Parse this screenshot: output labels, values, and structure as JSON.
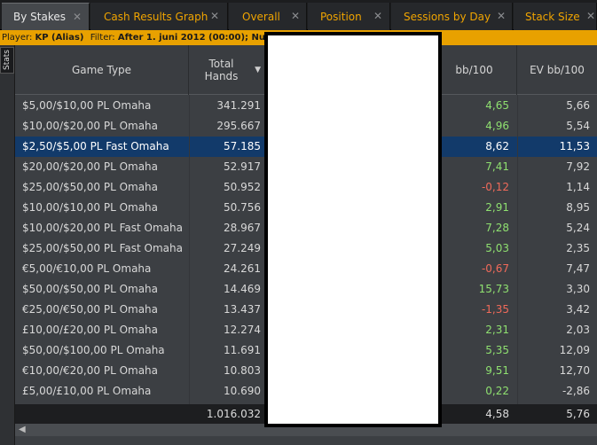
{
  "tabs": [
    {
      "label": "By Stakes",
      "active": true
    },
    {
      "label": "Cash Results Graph",
      "active": false
    },
    {
      "label": "Overall",
      "active": false
    },
    {
      "label": "Position",
      "active": false
    },
    {
      "label": "Sessions by Day",
      "active": false
    },
    {
      "label": "Stack Size",
      "active": false
    }
  ],
  "close_glyph": "✕",
  "filter": {
    "player_label": "Player:",
    "player_value": "KP (Alias)",
    "filter_label": "Filter:",
    "filter_value": "After 1. juni 2012 (00:00); Number"
  },
  "side_tab": "Stats",
  "columns": {
    "game_type": "Game Type",
    "total_hands": "Total Hands",
    "bb100": "bb/100",
    "ev_bb100": "EV bb/100"
  },
  "rows": [
    {
      "game": "$5,00/$10,00 PL Omaha",
      "hands": "341.291",
      "bb": "4,65",
      "bb_sign": "pos",
      "ev": "5,66"
    },
    {
      "game": "$10,00/$20,00 PL Omaha",
      "hands": "295.667",
      "bb": "4,96",
      "bb_sign": "pos",
      "ev": "5,54"
    },
    {
      "game": "$2,50/$5,00 PL Fast Omaha",
      "hands": "57.185",
      "bb": "8,62",
      "bb_sign": "pos",
      "ev": "11,53",
      "selected": true
    },
    {
      "game": "$20,00/$20,00 PL Omaha",
      "hands": "52.917",
      "bb": "7,41",
      "bb_sign": "pos",
      "ev": "7,92"
    },
    {
      "game": "$25,00/$50,00 PL Omaha",
      "hands": "50.952",
      "bb": "-0,12",
      "bb_sign": "neg",
      "ev": "1,14"
    },
    {
      "game": "$10,00/$10,00 PL Omaha",
      "hands": "50.756",
      "bb": "2,91",
      "bb_sign": "pos",
      "ev": "8,95"
    },
    {
      "game": "$10,00/$20,00 PL Fast Omaha",
      "hands": "28.967",
      "bb": "7,28",
      "bb_sign": "pos",
      "ev": "5,24"
    },
    {
      "game": "$25,00/$50,00 PL Fast Omaha",
      "hands": "27.249",
      "bb": "5,03",
      "bb_sign": "pos",
      "ev": "2,35"
    },
    {
      "game": "€5,00/€10,00 PL Omaha",
      "hands": "24.261",
      "bb": "-0,67",
      "bb_sign": "neg",
      "ev": "7,47"
    },
    {
      "game": "$50,00/$50,00 PL Omaha",
      "hands": "14.469",
      "bb": "15,73",
      "bb_sign": "pos",
      "ev": "3,30"
    },
    {
      "game": "€25,00/€50,00 PL Omaha",
      "hands": "13.437",
      "bb": "-1,35",
      "bb_sign": "neg",
      "ev": "3,42"
    },
    {
      "game": "£10,00/£20,00 PL Omaha",
      "hands": "12.274",
      "bb": "2,31",
      "bb_sign": "pos",
      "ev": "2,03"
    },
    {
      "game": "$50,00/$100,00 PL Omaha",
      "hands": "11.691",
      "bb": "5,35",
      "bb_sign": "pos",
      "ev": "12,09"
    },
    {
      "game": "€10,00/€20,00 PL Omaha",
      "hands": "10.803",
      "bb": "9,51",
      "bb_sign": "pos",
      "ev": "12,70"
    },
    {
      "game": "£5,00/£10,00 PL Omaha",
      "hands": "10.690",
      "bb": "0,22",
      "bb_sign": "pos",
      "ev": "-2,86"
    }
  ],
  "totals": {
    "hands": "1.016.032",
    "bb": "4,58",
    "ev": "5,76"
  },
  "colors": {
    "accent": "#e8a100",
    "positive": "#8fe070",
    "negative": "#f06a5a",
    "selected_row": "#123a6a"
  }
}
